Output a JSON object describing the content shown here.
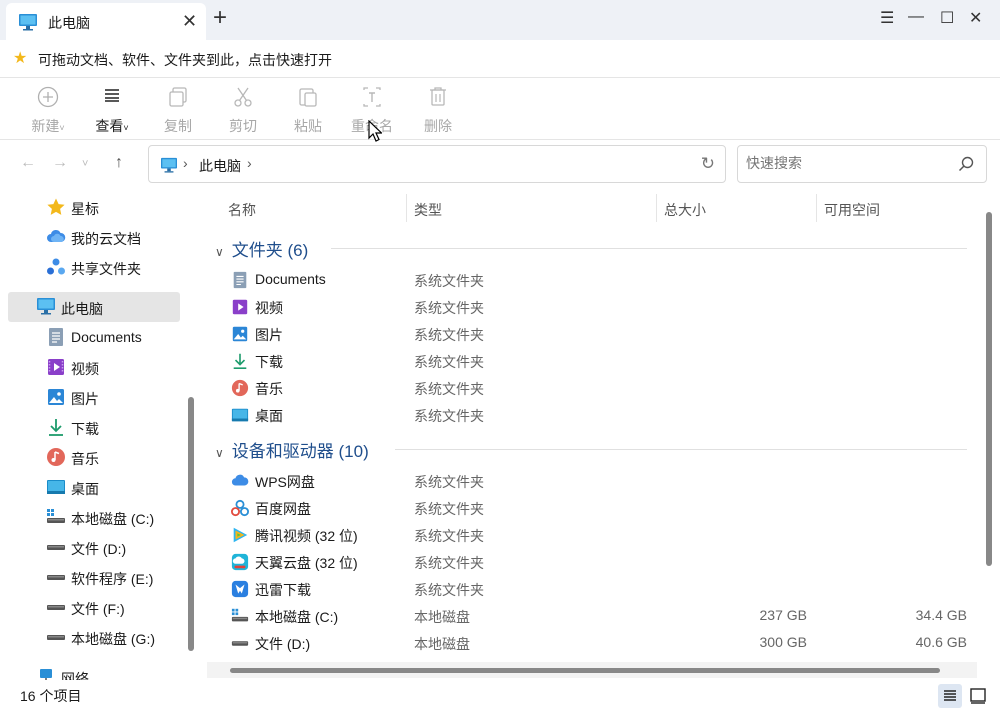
{
  "window": {
    "tab_title": "此电脑",
    "minimize": "—",
    "maximize": "☐",
    "close": "✕",
    "menu": "☰"
  },
  "favbar": {
    "text": "可拖动文档、软件、文件夹到此，点击快速打开"
  },
  "toolbar": {
    "new": "新建",
    "view": "查看",
    "copy": "复制",
    "cut": "剪切",
    "paste": "粘贴",
    "rename": "重命名",
    "delete": "删除"
  },
  "address": {
    "path": "此电脑"
  },
  "search": {
    "placeholder": "快速搜索"
  },
  "sidebar": {
    "items": [
      {
        "label": "星标",
        "icon": "star-icon"
      },
      {
        "label": "我的云文档",
        "icon": "cloud-icon"
      },
      {
        "label": "共享文件夹",
        "icon": "share-icon"
      },
      {
        "label": "此电脑",
        "icon": "pc-icon"
      },
      {
        "label": "Documents",
        "icon": "documents-icon"
      },
      {
        "label": "视频",
        "icon": "video-icon"
      },
      {
        "label": "图片",
        "icon": "picture-icon"
      },
      {
        "label": "下载",
        "icon": "download-icon"
      },
      {
        "label": "音乐",
        "icon": "music-icon"
      },
      {
        "label": "桌面",
        "icon": "desktop-icon"
      },
      {
        "label": "本地磁盘 (C:)",
        "icon": "drive-c-icon"
      },
      {
        "label": "文件 (D:)",
        "icon": "drive-icon"
      },
      {
        "label": "软件程序 (E:)",
        "icon": "drive-icon"
      },
      {
        "label": "文件 (F:)",
        "icon": "drive-icon"
      },
      {
        "label": "本地磁盘 (G:)",
        "icon": "drive-icon"
      },
      {
        "label": "网络",
        "icon": "network-icon"
      }
    ]
  },
  "columns": {
    "name": "名称",
    "type": "类型",
    "total": "总大小",
    "free": "可用空间"
  },
  "groups": {
    "folders": "文件夹 (6)",
    "devices": "设备和驱动器 (10)"
  },
  "folders": [
    {
      "name": "Documents",
      "type": "系统文件夹"
    },
    {
      "name": "视频",
      "type": "系统文件夹"
    },
    {
      "name": "图片",
      "type": "系统文件夹"
    },
    {
      "name": "下载",
      "type": "系统文件夹"
    },
    {
      "name": "音乐",
      "type": "系统文件夹"
    },
    {
      "name": "桌面",
      "type": "系统文件夹"
    }
  ],
  "devices": [
    {
      "name": "WPS网盘",
      "type": "系统文件夹",
      "size": "",
      "free": ""
    },
    {
      "name": "百度网盘",
      "type": "系统文件夹",
      "size": "",
      "free": ""
    },
    {
      "name": "腾讯视频 (32 位)",
      "type": "系统文件夹",
      "size": "",
      "free": ""
    },
    {
      "name": "天翼云盘 (32 位)",
      "type": "系统文件夹",
      "size": "",
      "free": ""
    },
    {
      "name": "迅雷下载",
      "type": "系统文件夹",
      "size": "",
      "free": ""
    },
    {
      "name": "本地磁盘 (C:)",
      "type": "本地磁盘",
      "size": "237 GB",
      "free": "34.4 GB"
    },
    {
      "name": "文件 (D:)",
      "type": "本地磁盘",
      "size": "300 GB",
      "free": "40.6 GB"
    }
  ],
  "status": {
    "count": "16 个项目"
  }
}
